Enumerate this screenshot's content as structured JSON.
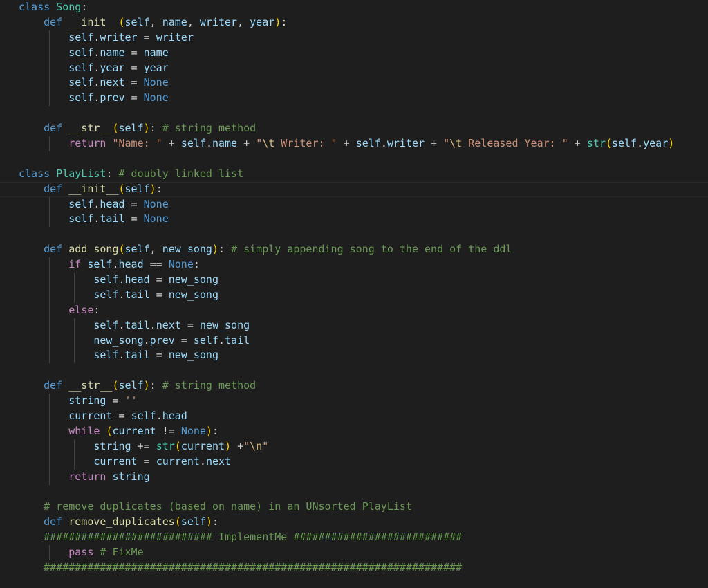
{
  "editor": {
    "language": "python",
    "lines": [
      {
        "tokens": [
          {
            "t": "class",
            "c": "k"
          },
          {
            "t": " ",
            "c": "o"
          },
          {
            "t": "Song",
            "c": "c"
          },
          {
            "t": ":",
            "c": "o"
          }
        ]
      },
      {
        "tokens": [
          {
            "t": "    ",
            "c": "o"
          },
          {
            "t": "def",
            "c": "k"
          },
          {
            "t": " ",
            "c": "o"
          },
          {
            "t": "__init__",
            "c": "f"
          },
          {
            "t": "(",
            "c": "b"
          },
          {
            "t": "self",
            "c": "v"
          },
          {
            "t": ", ",
            "c": "o"
          },
          {
            "t": "name",
            "c": "v"
          },
          {
            "t": ", ",
            "c": "o"
          },
          {
            "t": "writer",
            "c": "v"
          },
          {
            "t": ", ",
            "c": "o"
          },
          {
            "t": "year",
            "c": "v"
          },
          {
            "t": ")",
            "c": "b"
          },
          {
            "t": ":",
            "c": "o"
          }
        ]
      },
      {
        "tokens": [
          {
            "t": "        ",
            "c": "o"
          },
          {
            "t": "self",
            "c": "v"
          },
          {
            "t": ".",
            "c": "o"
          },
          {
            "t": "writer",
            "c": "v"
          },
          {
            "t": " = ",
            "c": "o"
          },
          {
            "t": "writer",
            "c": "v"
          }
        ]
      },
      {
        "tokens": [
          {
            "t": "        ",
            "c": "o"
          },
          {
            "t": "self",
            "c": "v"
          },
          {
            "t": ".",
            "c": "o"
          },
          {
            "t": "name",
            "c": "v"
          },
          {
            "t": " = ",
            "c": "o"
          },
          {
            "t": "name",
            "c": "v"
          }
        ]
      },
      {
        "tokens": [
          {
            "t": "        ",
            "c": "o"
          },
          {
            "t": "self",
            "c": "v"
          },
          {
            "t": ".",
            "c": "o"
          },
          {
            "t": "year",
            "c": "v"
          },
          {
            "t": " = ",
            "c": "o"
          },
          {
            "t": "year",
            "c": "v"
          }
        ]
      },
      {
        "tokens": [
          {
            "t": "        ",
            "c": "o"
          },
          {
            "t": "self",
            "c": "v"
          },
          {
            "t": ".",
            "c": "o"
          },
          {
            "t": "next",
            "c": "v"
          },
          {
            "t": " = ",
            "c": "o"
          },
          {
            "t": "None",
            "c": "k"
          }
        ]
      },
      {
        "tokens": [
          {
            "t": "        ",
            "c": "o"
          },
          {
            "t": "self",
            "c": "v"
          },
          {
            "t": ".",
            "c": "o"
          },
          {
            "t": "prev",
            "c": "v"
          },
          {
            "t": " = ",
            "c": "o"
          },
          {
            "t": "None",
            "c": "k"
          }
        ]
      },
      {
        "tokens": []
      },
      {
        "tokens": [
          {
            "t": "    ",
            "c": "o"
          },
          {
            "t": "def",
            "c": "k"
          },
          {
            "t": " ",
            "c": "o"
          },
          {
            "t": "__str__",
            "c": "f"
          },
          {
            "t": "(",
            "c": "b"
          },
          {
            "t": "self",
            "c": "v"
          },
          {
            "t": ")",
            "c": "b"
          },
          {
            "t": ": ",
            "c": "o"
          },
          {
            "t": "# string method",
            "c": "m"
          }
        ]
      },
      {
        "tokens": [
          {
            "t": "        ",
            "c": "o"
          },
          {
            "t": "return",
            "c": "p"
          },
          {
            "t": " ",
            "c": "o"
          },
          {
            "t": "\"Name: \"",
            "c": "s"
          },
          {
            "t": " + ",
            "c": "o"
          },
          {
            "t": "self",
            "c": "v"
          },
          {
            "t": ".",
            "c": "o"
          },
          {
            "t": "name",
            "c": "v"
          },
          {
            "t": " + ",
            "c": "o"
          },
          {
            "t": "\"",
            "c": "s"
          },
          {
            "t": "\\t",
            "c": "e"
          },
          {
            "t": " Writer: \"",
            "c": "s"
          },
          {
            "t": " + ",
            "c": "o"
          },
          {
            "t": "self",
            "c": "v"
          },
          {
            "t": ".",
            "c": "o"
          },
          {
            "t": "writer",
            "c": "v"
          },
          {
            "t": " + ",
            "c": "o"
          },
          {
            "t": "\"",
            "c": "s"
          },
          {
            "t": "\\t",
            "c": "e"
          },
          {
            "t": " Released Year: \"",
            "c": "s"
          },
          {
            "t": " + ",
            "c": "o"
          },
          {
            "t": "str",
            "c": "c"
          },
          {
            "t": "(",
            "c": "b"
          },
          {
            "t": "self",
            "c": "v"
          },
          {
            "t": ".",
            "c": "o"
          },
          {
            "t": "year",
            "c": "v"
          },
          {
            "t": ")",
            "c": "b"
          }
        ]
      },
      {
        "tokens": []
      },
      {
        "tokens": [
          {
            "t": "class",
            "c": "k"
          },
          {
            "t": " ",
            "c": "o"
          },
          {
            "t": "PlayList",
            "c": "c"
          },
          {
            "t": ": ",
            "c": "o"
          },
          {
            "t": "# doubly linked list",
            "c": "m"
          }
        ]
      },
      {
        "current": true,
        "tokens": [
          {
            "t": "    ",
            "c": "o"
          },
          {
            "t": "def",
            "c": "k"
          },
          {
            "t": " ",
            "c": "o"
          },
          {
            "t": "__init__",
            "c": "f"
          },
          {
            "t": "(",
            "c": "b"
          },
          {
            "t": "self",
            "c": "v"
          },
          {
            "t": ")",
            "c": "b"
          },
          {
            "t": ":",
            "c": "o"
          }
        ]
      },
      {
        "tokens": [
          {
            "t": "        ",
            "c": "o"
          },
          {
            "t": "self",
            "c": "v"
          },
          {
            "t": ".",
            "c": "o"
          },
          {
            "t": "head",
            "c": "v"
          },
          {
            "t": " = ",
            "c": "o"
          },
          {
            "t": "None",
            "c": "k"
          }
        ]
      },
      {
        "tokens": [
          {
            "t": "        ",
            "c": "o"
          },
          {
            "t": "self",
            "c": "v"
          },
          {
            "t": ".",
            "c": "o"
          },
          {
            "t": "tail",
            "c": "v"
          },
          {
            "t": " = ",
            "c": "o"
          },
          {
            "t": "None",
            "c": "k"
          }
        ]
      },
      {
        "tokens": []
      },
      {
        "tokens": [
          {
            "t": "    ",
            "c": "o"
          },
          {
            "t": "def",
            "c": "k"
          },
          {
            "t": " ",
            "c": "o"
          },
          {
            "t": "add_song",
            "c": "f"
          },
          {
            "t": "(",
            "c": "b"
          },
          {
            "t": "self",
            "c": "v"
          },
          {
            "t": ", ",
            "c": "o"
          },
          {
            "t": "new_song",
            "c": "v"
          },
          {
            "t": ")",
            "c": "b"
          },
          {
            "t": ": ",
            "c": "o"
          },
          {
            "t": "# simply appending song to the end of the ddl",
            "c": "m"
          }
        ]
      },
      {
        "tokens": [
          {
            "t": "        ",
            "c": "o"
          },
          {
            "t": "if",
            "c": "p"
          },
          {
            "t": " ",
            "c": "o"
          },
          {
            "t": "self",
            "c": "v"
          },
          {
            "t": ".",
            "c": "o"
          },
          {
            "t": "head",
            "c": "v"
          },
          {
            "t": " == ",
            "c": "o"
          },
          {
            "t": "None",
            "c": "k"
          },
          {
            "t": ":",
            "c": "o"
          }
        ]
      },
      {
        "tokens": [
          {
            "t": "            ",
            "c": "o"
          },
          {
            "t": "self",
            "c": "v"
          },
          {
            "t": ".",
            "c": "o"
          },
          {
            "t": "head",
            "c": "v"
          },
          {
            "t": " = ",
            "c": "o"
          },
          {
            "t": "new_song",
            "c": "v"
          }
        ]
      },
      {
        "tokens": [
          {
            "t": "            ",
            "c": "o"
          },
          {
            "t": "self",
            "c": "v"
          },
          {
            "t": ".",
            "c": "o"
          },
          {
            "t": "tail",
            "c": "v"
          },
          {
            "t": " = ",
            "c": "o"
          },
          {
            "t": "new_song",
            "c": "v"
          }
        ]
      },
      {
        "tokens": [
          {
            "t": "        ",
            "c": "o"
          },
          {
            "t": "else",
            "c": "p"
          },
          {
            "t": ":",
            "c": "o"
          }
        ]
      },
      {
        "tokens": [
          {
            "t": "            ",
            "c": "o"
          },
          {
            "t": "self",
            "c": "v"
          },
          {
            "t": ".",
            "c": "o"
          },
          {
            "t": "tail",
            "c": "v"
          },
          {
            "t": ".",
            "c": "o"
          },
          {
            "t": "next",
            "c": "v"
          },
          {
            "t": " = ",
            "c": "o"
          },
          {
            "t": "new_song",
            "c": "v"
          }
        ]
      },
      {
        "tokens": [
          {
            "t": "            ",
            "c": "o"
          },
          {
            "t": "new_song",
            "c": "v"
          },
          {
            "t": ".",
            "c": "o"
          },
          {
            "t": "prev",
            "c": "v"
          },
          {
            "t": " = ",
            "c": "o"
          },
          {
            "t": "self",
            "c": "v"
          },
          {
            "t": ".",
            "c": "o"
          },
          {
            "t": "tail",
            "c": "v"
          }
        ]
      },
      {
        "tokens": [
          {
            "t": "            ",
            "c": "o"
          },
          {
            "t": "self",
            "c": "v"
          },
          {
            "t": ".",
            "c": "o"
          },
          {
            "t": "tail",
            "c": "v"
          },
          {
            "t": " = ",
            "c": "o"
          },
          {
            "t": "new_song",
            "c": "v"
          }
        ]
      },
      {
        "tokens": []
      },
      {
        "tokens": [
          {
            "t": "    ",
            "c": "o"
          },
          {
            "t": "def",
            "c": "k"
          },
          {
            "t": " ",
            "c": "o"
          },
          {
            "t": "__str__",
            "c": "f"
          },
          {
            "t": "(",
            "c": "b"
          },
          {
            "t": "self",
            "c": "v"
          },
          {
            "t": ")",
            "c": "b"
          },
          {
            "t": ": ",
            "c": "o"
          },
          {
            "t": "# string method",
            "c": "m"
          }
        ]
      },
      {
        "tokens": [
          {
            "t": "        ",
            "c": "o"
          },
          {
            "t": "string",
            "c": "v"
          },
          {
            "t": " = ",
            "c": "o"
          },
          {
            "t": "''",
            "c": "s"
          }
        ]
      },
      {
        "tokens": [
          {
            "t": "        ",
            "c": "o"
          },
          {
            "t": "current",
            "c": "v"
          },
          {
            "t": " = ",
            "c": "o"
          },
          {
            "t": "self",
            "c": "v"
          },
          {
            "t": ".",
            "c": "o"
          },
          {
            "t": "head",
            "c": "v"
          }
        ]
      },
      {
        "tokens": [
          {
            "t": "        ",
            "c": "o"
          },
          {
            "t": "while",
            "c": "p"
          },
          {
            "t": " ",
            "c": "o"
          },
          {
            "t": "(",
            "c": "b"
          },
          {
            "t": "current",
            "c": "v"
          },
          {
            "t": " != ",
            "c": "o"
          },
          {
            "t": "None",
            "c": "k"
          },
          {
            "t": ")",
            "c": "b"
          },
          {
            "t": ":",
            "c": "o"
          }
        ]
      },
      {
        "tokens": [
          {
            "t": "            ",
            "c": "o"
          },
          {
            "t": "string",
            "c": "v"
          },
          {
            "t": " += ",
            "c": "o"
          },
          {
            "t": "str",
            "c": "c"
          },
          {
            "t": "(",
            "c": "b"
          },
          {
            "t": "current",
            "c": "v"
          },
          {
            "t": ")",
            "c": "b"
          },
          {
            "t": " +",
            "c": "o"
          },
          {
            "t": "\"",
            "c": "s"
          },
          {
            "t": "\\n",
            "c": "e"
          },
          {
            "t": "\"",
            "c": "s"
          }
        ]
      },
      {
        "tokens": [
          {
            "t": "            ",
            "c": "o"
          },
          {
            "t": "current",
            "c": "v"
          },
          {
            "t": " = ",
            "c": "o"
          },
          {
            "t": "current",
            "c": "v"
          },
          {
            "t": ".",
            "c": "o"
          },
          {
            "t": "next",
            "c": "v"
          }
        ]
      },
      {
        "tokens": [
          {
            "t": "        ",
            "c": "o"
          },
          {
            "t": "return",
            "c": "p"
          },
          {
            "t": " ",
            "c": "o"
          },
          {
            "t": "string",
            "c": "v"
          }
        ]
      },
      {
        "tokens": []
      },
      {
        "tokens": [
          {
            "t": "    ",
            "c": "o"
          },
          {
            "t": "# remove duplicates (based on name) in an UNsorted PlayList",
            "c": "m"
          }
        ]
      },
      {
        "tokens": [
          {
            "t": "    ",
            "c": "o"
          },
          {
            "t": "def",
            "c": "k"
          },
          {
            "t": " ",
            "c": "o"
          },
          {
            "t": "remove_duplicates",
            "c": "f"
          },
          {
            "t": "(",
            "c": "b"
          },
          {
            "t": "self",
            "c": "v"
          },
          {
            "t": ")",
            "c": "b"
          },
          {
            "t": ":",
            "c": "o"
          }
        ]
      },
      {
        "tokens": [
          {
            "t": "    ",
            "c": "o"
          },
          {
            "t": "########################### ImplementMe ###########################",
            "c": "m"
          }
        ]
      },
      {
        "tokens": [
          {
            "t": "        ",
            "c": "o"
          },
          {
            "t": "pass",
            "c": "p"
          },
          {
            "t": " ",
            "c": "o"
          },
          {
            "t": "# FixMe",
            "c": "m"
          }
        ]
      },
      {
        "tokens": [
          {
            "t": "    ",
            "c": "o"
          },
          {
            "t": "###################################################################",
            "c": "m"
          }
        ]
      }
    ]
  },
  "colors": {
    "background": "#1e1e1e",
    "keyword": "#569cd6",
    "class": "#4ec9b0",
    "function": "#dcdcaa",
    "variable": "#9cdcfe",
    "string": "#ce9178",
    "escape": "#d7ba7d",
    "comment": "#6a9955",
    "control": "#c586c0",
    "bracket": "#ffd700"
  }
}
